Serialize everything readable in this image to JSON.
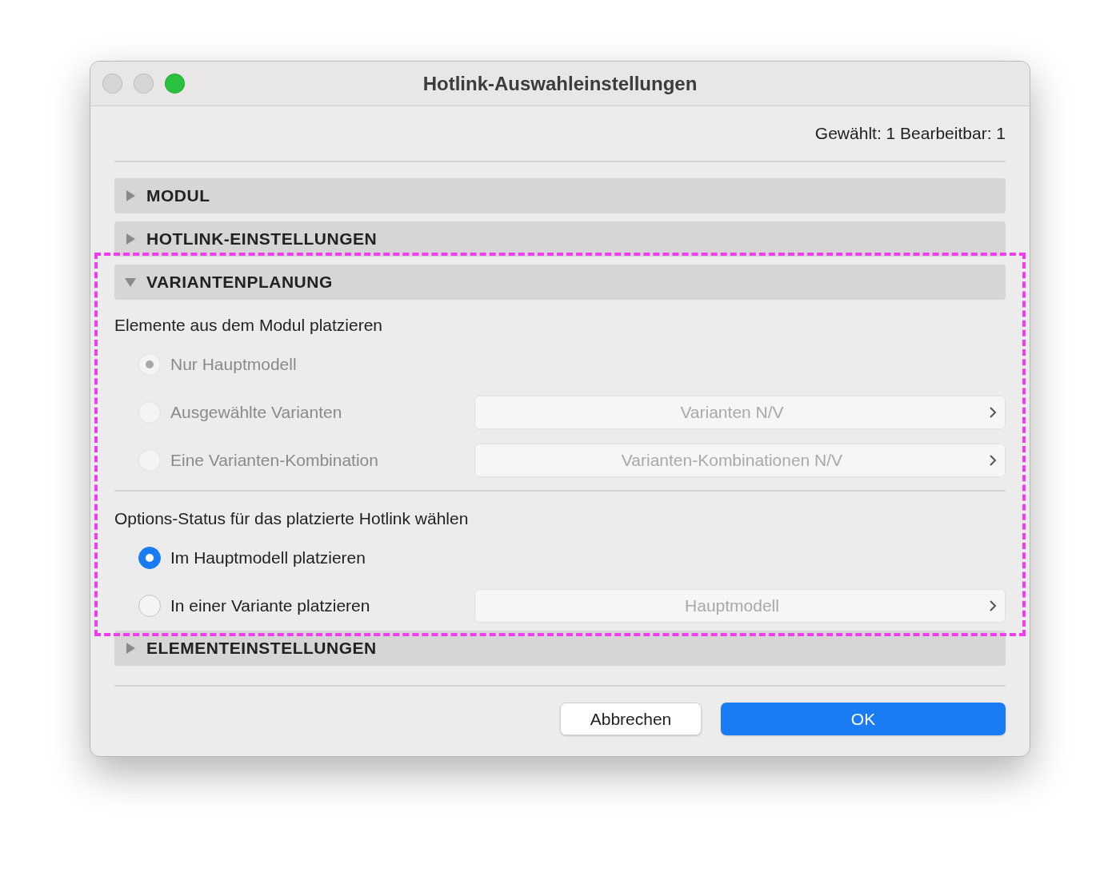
{
  "window": {
    "title": "Hotlink-Auswahleinstellungen"
  },
  "status": "Gewählt: 1 Bearbeitbar: 1",
  "sections": [
    {
      "title": "MODUL",
      "expanded": false
    },
    {
      "title": "HOTLINK-EINSTELLUNGEN",
      "expanded": false
    },
    {
      "title": "VARIANTENPLANUNG",
      "expanded": true,
      "groups": [
        {
          "heading": "Elemente aus dem Modul platzieren",
          "options": [
            {
              "label": "Nur Hauptmodell",
              "selected": true,
              "disabled": true
            },
            {
              "label": "Ausgewählte Varianten",
              "selected": false,
              "disabled": true,
              "popup": {
                "value": "Varianten N/V",
                "disabled": true
              }
            },
            {
              "label": "Eine Varianten-Kombination",
              "selected": false,
              "disabled": true,
              "popup": {
                "value": "Varianten-Kombinationen N/V",
                "disabled": true
              }
            }
          ]
        },
        {
          "heading": "Options-Status für das platzierte Hotlink wählen",
          "options": [
            {
              "label": "Im Hauptmodell platzieren",
              "selected": true,
              "disabled": false
            },
            {
              "label": "In einer Variante platzieren",
              "selected": false,
              "disabled": false,
              "popup": {
                "value": "Hauptmodell",
                "disabled": true
              }
            }
          ]
        }
      ]
    },
    {
      "title": "ELEMENTEINSTELLUNGEN",
      "expanded": false
    }
  ],
  "buttons": [
    {
      "label": "Abbrechen",
      "kind": "secondary"
    },
    {
      "label": "OK",
      "kind": "primary"
    }
  ]
}
